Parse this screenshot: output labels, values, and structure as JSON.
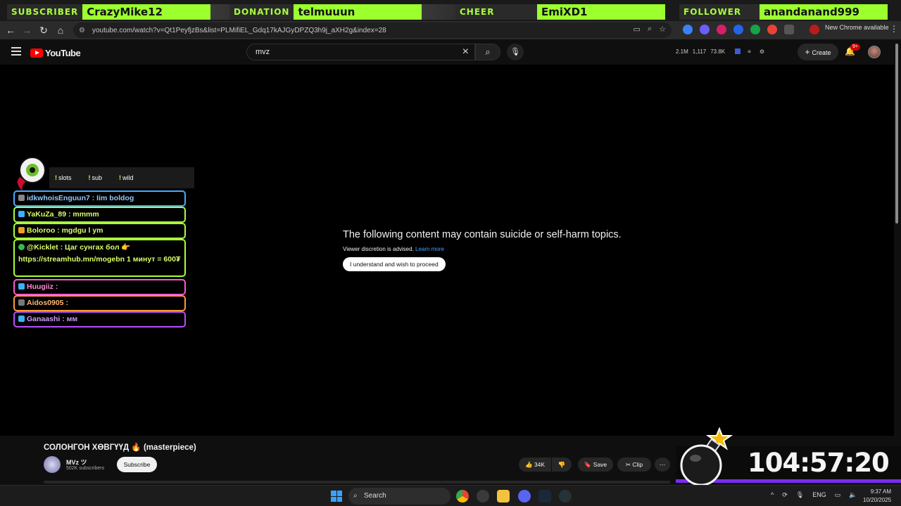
{
  "alerts": [
    {
      "label": "SUBSCRIBER",
      "name": "CrazyMike12"
    },
    {
      "label": "DONATION",
      "name": "telmuuun"
    },
    {
      "label": "CHEER",
      "name": "EmiXD1"
    },
    {
      "label": "FOLLOWER",
      "name": "anandanand999"
    }
  ],
  "browser": {
    "url": "youtube.com/watch?v=Qt1PeyfjzBs&list=PLMifiEL_Gdq17kAJGyDPZQ3h9j_aXH2g&index=28",
    "new_chrome": "New Chrome available"
  },
  "header": {
    "logo": "YouTube",
    "search_value": "mvz",
    "stats": [
      "2.1M",
      "1,117",
      "73.8K"
    ],
    "create": "Create",
    "notifications": "9+"
  },
  "player": {
    "warning_title": "The following content may contain suicide or self-harm topics.",
    "discretion": "Viewer discretion is advised.",
    "learn_more": "Learn more",
    "proceed": "I understand and wish to proceed"
  },
  "overlay": {
    "commands": [
      "slots",
      "sub",
      "wild"
    ],
    "chat": [
      {
        "text": "idkwhoisEnguun7 : Iim boldog",
        "color": "#4ea8ff"
      },
      {
        "text": "YaKuZa_89 : mmmm",
        "color": "#a8ff3a"
      },
      {
        "text": "Boloroo : mgdgu l ym",
        "color": "#a8ff3a"
      },
      {
        "text": "@Kicklet : Цаг сунгах бол 👉 https://streamhub.mn/mogebn 1 минут = 600₮",
        "color": "#a8ff3a"
      },
      {
        "text": "Huugiiz :",
        "color": "#ff5ac8"
      },
      {
        "text": "Aidos0905 :",
        "color": "#ff9a3a"
      },
      {
        "text": "Ganaashi : мм",
        "color": "#b84dff"
      }
    ],
    "timer": "104:57:20"
  },
  "video": {
    "title": "СОЛОНГОН ХӨВГҮҮД 🔥 (masterpiece)",
    "channel": "MVz ツ",
    "subscribers": "502K subscribers",
    "subscribe": "Subscribe",
    "likes": "34K",
    "save": "Save",
    "clip": "Clip"
  },
  "taskbar": {
    "search": "Search",
    "lang": "ENG",
    "time": "9:37 AM",
    "date": "10/20/2025"
  }
}
